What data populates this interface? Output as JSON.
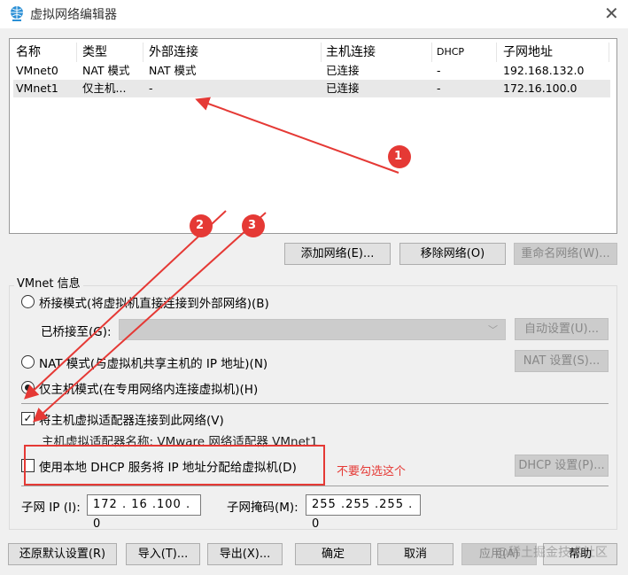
{
  "window": {
    "title": "虚拟网络编辑器",
    "icon": "globe-network-icon"
  },
  "table": {
    "columns": [
      "名称",
      "类型",
      "外部连接",
      "主机连接",
      "DHCP",
      "子网地址"
    ],
    "rows": [
      [
        "VMnet0",
        "NAT 模式",
        "NAT 模式",
        "已连接",
        "-",
        "192.168.132.0"
      ],
      [
        "VMnet1",
        "仅主机...",
        "-",
        "已连接",
        "-",
        "172.16.100.0"
      ]
    ],
    "selected_row": 1
  },
  "list_buttons": {
    "add": "添加网络(E)...",
    "remove": "移除网络(O)",
    "rename": "重命名网络(W)..."
  },
  "vmnet_info": {
    "group_label": "VMnet 信息",
    "bridge_mode": "桥接模式(将虚拟机直接连接到外部网络)(B)",
    "bridged_to_label": "已桥接至(G):",
    "auto_settings": "自动设置(U)...",
    "nat_mode": "NAT 模式(与虚拟机共享主机的 IP 地址)(N)",
    "nat_settings": "NAT 设置(S)...",
    "host_only_mode": "仅主机模式(在专用网络内连接虚拟机)(H)",
    "selected_mode": "host_only",
    "connect_adapter": "将主机虚拟适配器连接到此网络(V)",
    "connect_adapter_checked": true,
    "adapter_name": "主机虚拟适配器名称: VMware 网络适配器 VMnet1",
    "use_dhcp": "使用本地 DHCP 服务将 IP 地址分配给虚拟机(D)",
    "use_dhcp_checked": false,
    "dhcp_settings": "DHCP 设置(P)...",
    "subnet_ip_label": "子网 IP (I):",
    "subnet_ip": "172 . 16 .100 . 0",
    "subnet_mask_label": "子网掩码(M):",
    "subnet_mask": "255 .255 .255 . 0"
  },
  "annotations": {
    "markers": [
      "1",
      "2",
      "3"
    ],
    "note": "不要勾选这个",
    "color": "#e53935"
  },
  "bottom_buttons": {
    "restore": "还原默认设置(R)",
    "import": "导入(T)...",
    "export": "导出(X)...",
    "ok": "确定",
    "cancel": "取消",
    "apply": "应用(A)",
    "help": "帮助"
  },
  "watermark": "@稀土掘金技术社区"
}
